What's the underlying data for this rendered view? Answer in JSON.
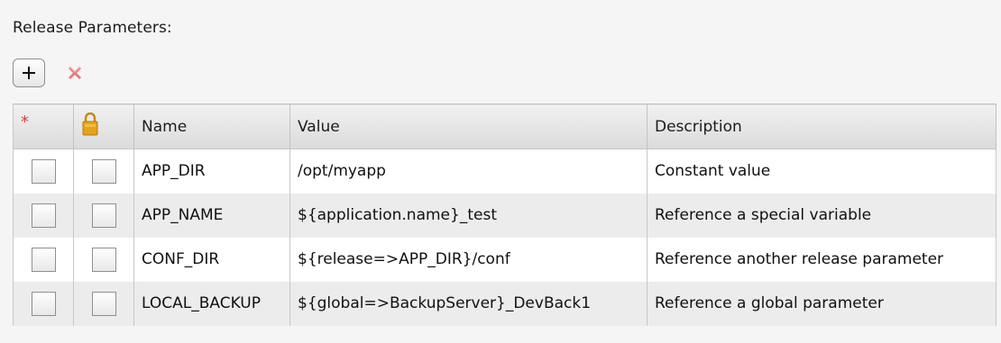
{
  "section": {
    "title": "Release Parameters:"
  },
  "toolbar": {
    "add_icon": "plus-icon",
    "remove_icon": "remove-icon"
  },
  "table": {
    "headers": {
      "required_icon": "required-asterisk-icon",
      "locked_icon": "lock-icon",
      "name": "Name",
      "value": "Value",
      "description": "Description"
    },
    "rows": [
      {
        "required": false,
        "locked": false,
        "name": "APP_DIR",
        "value": "/opt/myapp",
        "description": "Constant value"
      },
      {
        "required": false,
        "locked": false,
        "name": "APP_NAME",
        "value": "${application.name}_test",
        "description": "Reference a special variable"
      },
      {
        "required": false,
        "locked": false,
        "name": "CONF_DIR",
        "value": "${release=>APP_DIR}/conf",
        "description": "Reference another release parameter"
      },
      {
        "required": false,
        "locked": false,
        "name": "LOCAL_BACKUP",
        "value": "${global=>BackupServer}_DevBack1",
        "description": "Reference a global parameter"
      }
    ]
  },
  "colors": {
    "required": "#e43b3b",
    "lock": "#d89b16",
    "remove": "#e87a7a"
  }
}
